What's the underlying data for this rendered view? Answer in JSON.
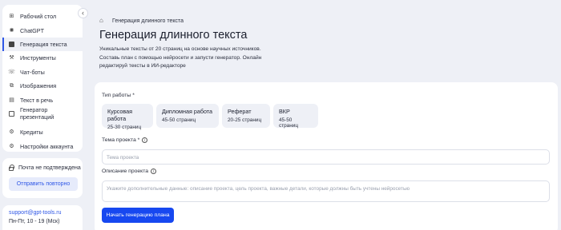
{
  "sidebar": {
    "items": [
      {
        "label": "Рабочий стол",
        "icon": "dashboard-icon"
      },
      {
        "label": "ChatGPT",
        "icon": "chatgpt-icon"
      },
      {
        "label": "Генерация текста",
        "icon": "text-generation-icon",
        "active": true
      },
      {
        "label": "Инструменты",
        "icon": "tools-icon"
      },
      {
        "label": "Чат-боты",
        "icon": "chatbot-icon"
      },
      {
        "label": "Изображения",
        "icon": "images-icon"
      },
      {
        "label": "Текст в речь",
        "icon": "text-to-speech-icon"
      },
      {
        "label": "Генератор презентаций",
        "icon": "presentation-icon"
      },
      {
        "label": "Кредиты",
        "icon": "credits-icon"
      },
      {
        "label": "Настройки аккаунта",
        "icon": "settings-icon"
      }
    ]
  },
  "verify": {
    "status": "Почта не подтверждена",
    "resend_label": "Отправить повторно"
  },
  "support": {
    "email": "support@gpt-tools.ru",
    "hours": "Пн-Пт, 10 - 19 (Мск)"
  },
  "header": {
    "breadcrumb": "Генерация длинного текста",
    "title": "Генерация длинного текста",
    "description": "Уникальные тексты от 20 страниц на основе научных источников. Составь план с помощью нейросети и запусти генератор. Онлайн редактируй тексты в ИИ-редакторе"
  },
  "form": {
    "work_type_label": "Тип работы *",
    "options": [
      {
        "title": "Курсовая работа",
        "pages": "25-30 страниц"
      },
      {
        "title": "Дипломная работа",
        "pages": "45-50 страниц"
      },
      {
        "title": "Реферат",
        "pages": "20-25 страниц"
      },
      {
        "title": "ВКР",
        "pages": "45-50 страниц"
      }
    ],
    "topic_label": "Тема проекта *",
    "topic_placeholder": "Тема проекта",
    "desc_label": "Описание проекта",
    "desc_placeholder": "Укажите дополнительные данные: описание проекта, цель проекта, важные детали, которые должны быть учтены нейросетью",
    "start_label": "Начать генерацию плана"
  },
  "colors": {
    "accent": "#1748f0",
    "background": "#eef0f6"
  }
}
